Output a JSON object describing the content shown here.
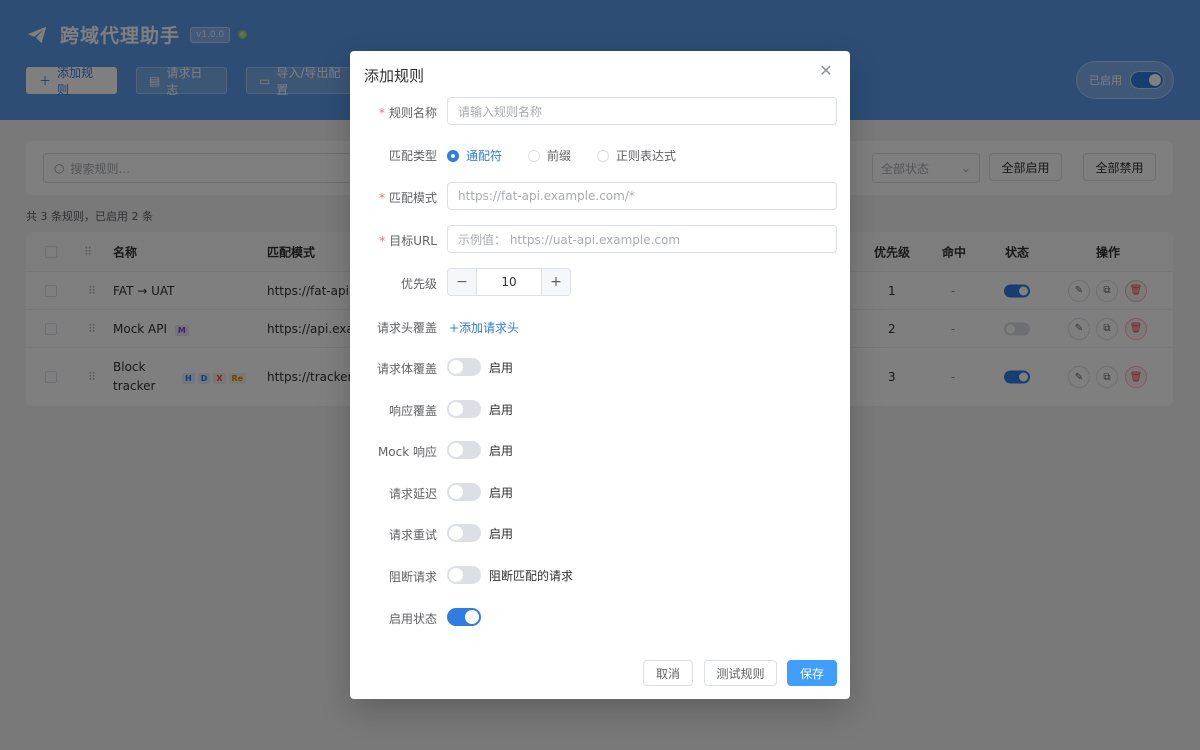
{
  "header": {
    "title": "跨域代理助手",
    "version": "v1.0.0",
    "buttons": {
      "add": "添加规则",
      "logs": "请求日志",
      "import_export": "导入/导出配置"
    },
    "global_switch_label": "已启用",
    "global_enabled": true
  },
  "toolbar": {
    "search_placeholder": "搜索规则...",
    "status_select": "全部状态",
    "enable_all": "全部启用",
    "disable_all": "全部禁用"
  },
  "summary": "共 3 条规则，已启用 2 条",
  "table": {
    "columns": {
      "name": "名称",
      "pattern": "匹配模式",
      "priority": "优先级",
      "hits": "命中",
      "status": "状态",
      "actions": "操作"
    },
    "rows": [
      {
        "name": "FAT → UAT",
        "pattern": "https://fat-api.e",
        "priority": "1",
        "hits": "-",
        "enabled": true,
        "tags": []
      },
      {
        "name": "Mock API",
        "pattern": "https://api.exan",
        "priority": "2",
        "hits": "-",
        "enabled": false,
        "tags": [
          "M"
        ]
      },
      {
        "name_line1": "Block",
        "name_line2": "tracker",
        "pattern": "https://tracker.e",
        "priority": "3",
        "hits": "-",
        "enabled": true,
        "tags": [
          "H",
          "D",
          "X",
          "Re"
        ]
      }
    ]
  },
  "dialog": {
    "title": "添加规则",
    "fields": {
      "name": {
        "label": "规则名称",
        "placeholder": "请输入规则名称"
      },
      "match_type": {
        "label": "匹配类型",
        "options": [
          "通配符",
          "前缀",
          "正则表达式"
        ],
        "selected": "通配符"
      },
      "pattern": {
        "label": "匹配模式",
        "placeholder": "https://fat-api.example.com/*"
      },
      "target": {
        "label": "目标URL",
        "placeholder": "示例值： https://uat-api.example.com"
      },
      "priority": {
        "label": "优先级",
        "value": "10"
      },
      "req_headers": {
        "label": "请求头覆盖",
        "link": "+添加请求头"
      },
      "req_body": {
        "label": "请求体覆盖",
        "text": "启用",
        "on": false
      },
      "resp": {
        "label": "响应覆盖",
        "text": "启用",
        "on": false
      },
      "mock": {
        "label": "Mock 响应",
        "text": "启用",
        "on": false
      },
      "delay": {
        "label": "请求延迟",
        "text": "启用",
        "on": false
      },
      "retry": {
        "label": "请求重试",
        "text": "启用",
        "on": false
      },
      "block": {
        "label": "阻断请求",
        "text": "阻断匹配的请求",
        "on": false
      },
      "enabled": {
        "label": "启用状态",
        "on": true
      }
    },
    "buttons": {
      "cancel": "取消",
      "test": "测试规则",
      "save": "保存"
    }
  }
}
